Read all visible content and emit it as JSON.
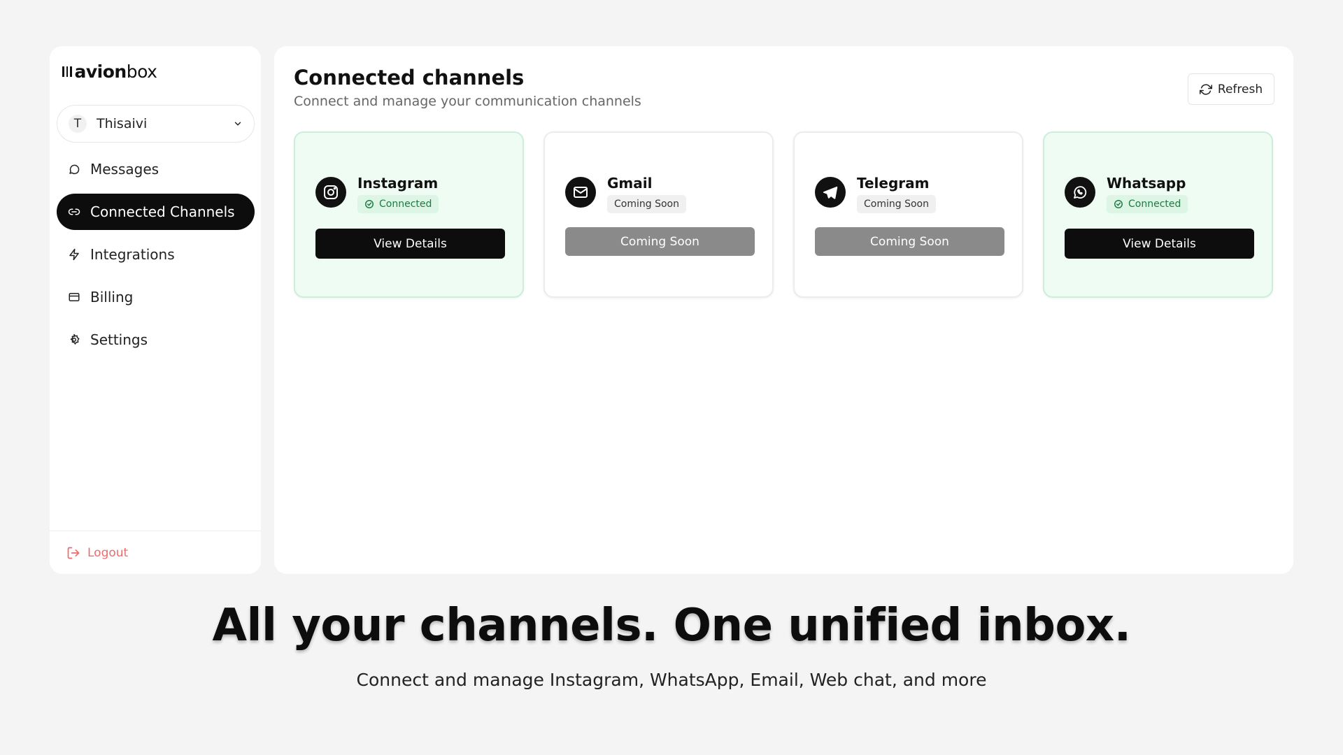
{
  "brand": {
    "bold": "avion",
    "light": "box"
  },
  "user": {
    "initial": "T",
    "name": "Thisaivi"
  },
  "nav": [
    {
      "label": "Messages",
      "icon": "chat-bubble-icon",
      "active": false
    },
    {
      "label": "Connected Channels",
      "icon": "link-icon",
      "active": true
    },
    {
      "label": "Integrations",
      "icon": "lightning-icon",
      "active": false
    },
    {
      "label": "Billing",
      "icon": "credit-card-icon",
      "active": false
    },
    {
      "label": "Settings",
      "icon": "gear-icon",
      "active": false
    }
  ],
  "logout": {
    "label": "Logout",
    "color": "#ef6b6b"
  },
  "main": {
    "title": "Connected channels",
    "subtitle": "Connect and manage your communication channels",
    "refresh_label": "Refresh"
  },
  "channels": [
    {
      "name": "Instagram",
      "icon": "instagram-icon",
      "status": "Connected",
      "button": "View Details"
    },
    {
      "name": "Gmail",
      "icon": "mail-icon",
      "status": "Coming Soon",
      "button": "Coming Soon"
    },
    {
      "name": "Telegram",
      "icon": "telegram-icon",
      "status": "Coming Soon",
      "button": "Coming Soon"
    },
    {
      "name": "Whatsapp",
      "icon": "whatsapp-icon",
      "status": "Connected",
      "button": "View Details"
    }
  ],
  "headline": "All your channels. One unified inbox.",
  "tagline": "Connect and manage Instagram, WhatsApp, Email, Web chat, and more",
  "colors": {
    "connected_bg": "#effcf3",
    "connected_text": "#1f7a45",
    "active_nav": "#0d0d0d"
  }
}
